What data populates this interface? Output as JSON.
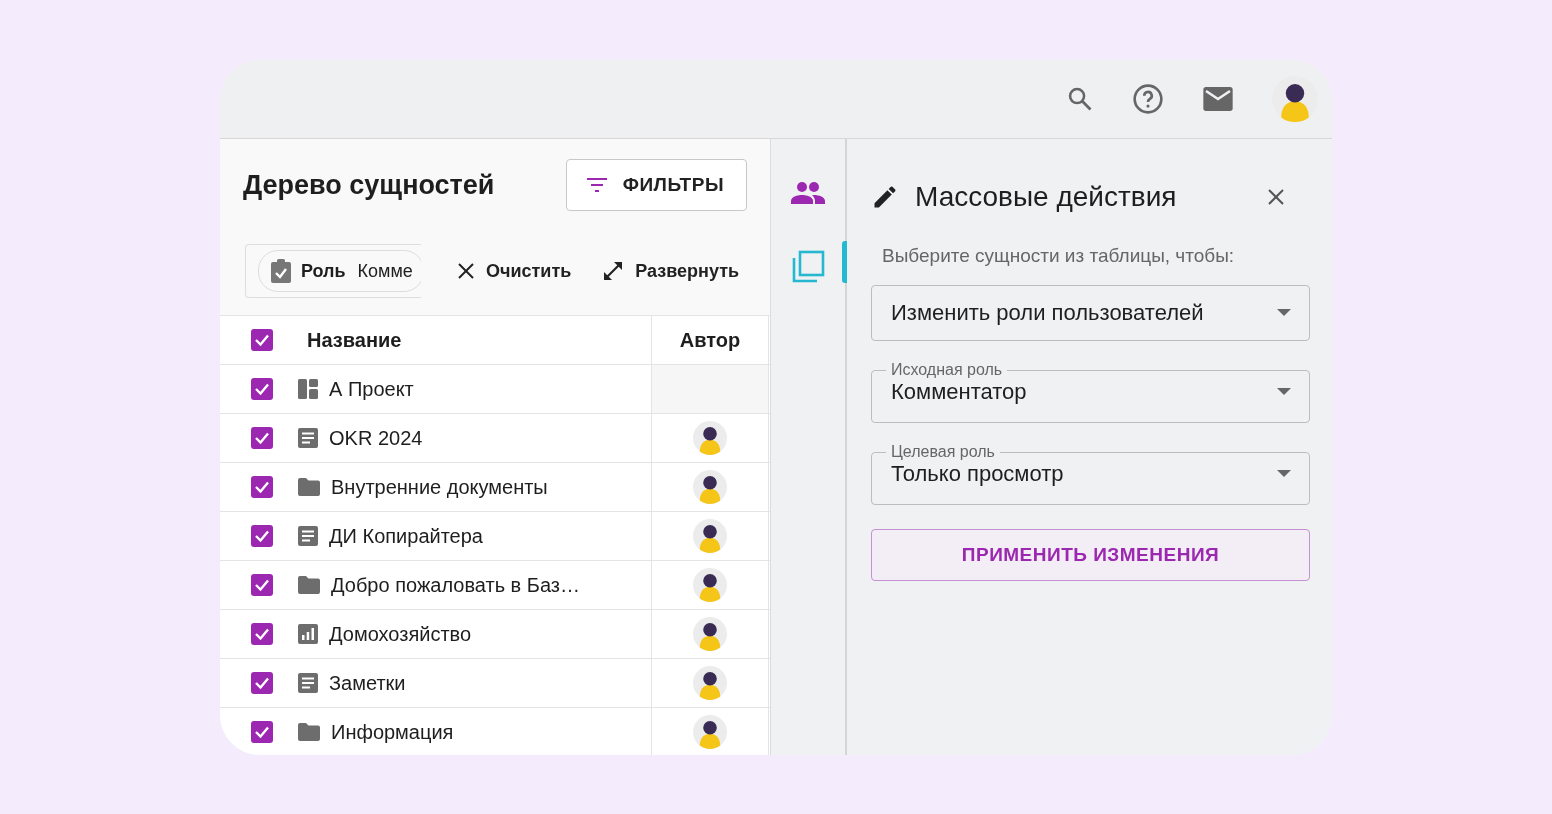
{
  "tree": {
    "title": "Дерево сущностей",
    "filter_button": "ФИЛЬТРЫ",
    "chip": {
      "label": "Роль",
      "value": "Комме"
    },
    "clear_button": "Очистить",
    "expand_button": "Развернуть",
    "columns": [
      "Название",
      "Автор"
    ],
    "all_checked": true,
    "rows": [
      {
        "kind": "board",
        "name": "А Проект",
        "checked": true,
        "has_author": false
      },
      {
        "kind": "doc",
        "name": "OKR 2024",
        "checked": true,
        "has_author": true
      },
      {
        "kind": "folder",
        "name": "Внутренние документы",
        "checked": true,
        "has_author": true
      },
      {
        "kind": "doc",
        "name": "ДИ Копирайтера",
        "checked": true,
        "has_author": true
      },
      {
        "kind": "folder",
        "name": "Добро пожаловать в Баз…",
        "checked": true,
        "has_author": true
      },
      {
        "kind": "chart",
        "name": "Домохозяйство",
        "checked": true,
        "has_author": true
      },
      {
        "kind": "doc",
        "name": "Заметки",
        "checked": true,
        "has_author": true
      },
      {
        "kind": "folder",
        "name": "Информация",
        "checked": true,
        "has_author": true
      }
    ]
  },
  "rail": [
    {
      "kind": "people",
      "selected": false
    },
    {
      "kind": "copy",
      "selected": true
    }
  ],
  "panel": {
    "title": "Массовые действия",
    "hint": "Выберите сущности из таблицы, чтобы:",
    "action": {
      "value": "Изменить роли пользователей"
    },
    "fields": [
      {
        "label": "Исходная роль",
        "value": "Комментатор"
      },
      {
        "label": "Целевая роль",
        "value": "Только просмотр"
      }
    ],
    "apply_button": "ПРИМЕНИТЬ ИЗМЕНЕНИЯ"
  }
}
